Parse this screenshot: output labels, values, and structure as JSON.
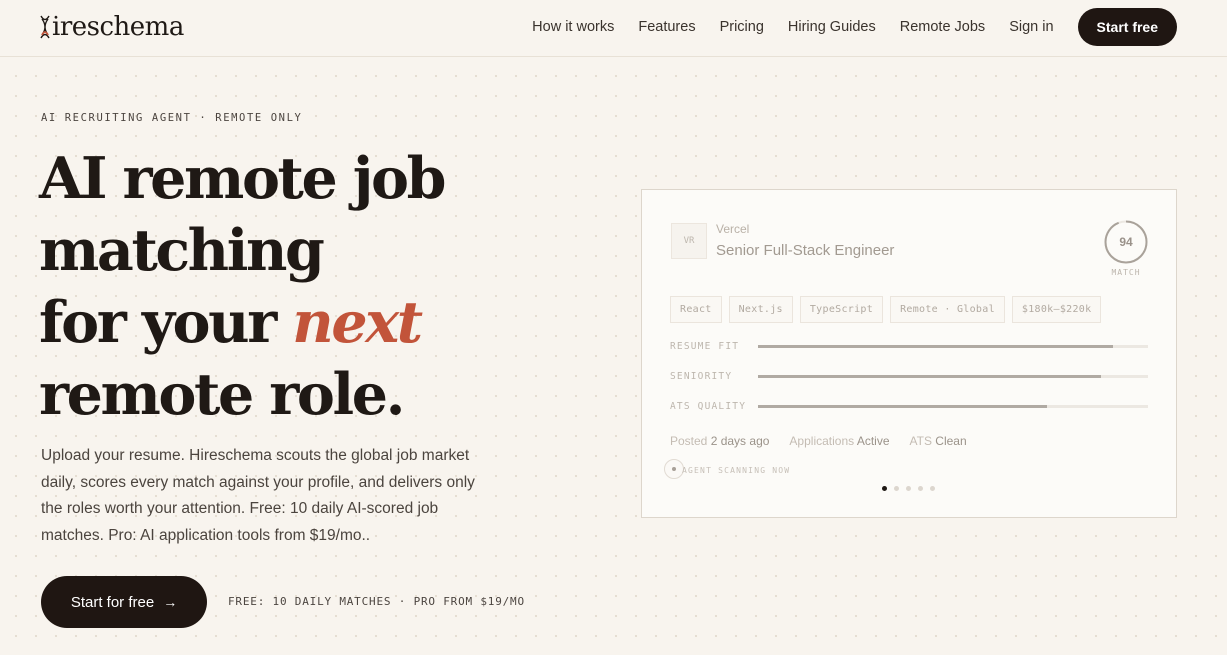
{
  "brand": {
    "name": "ireschema",
    "mark_color": "#c2543a"
  },
  "nav": {
    "links": [
      "How it works",
      "Features",
      "Pricing",
      "Hiring Guides",
      "Remote Jobs",
      "Sign in"
    ],
    "cta": "Start free"
  },
  "hero": {
    "eyebrow": "AI RECRUITING AGENT · REMOTE ONLY",
    "headline_line1": "AI remote job",
    "headline_line2": "matching",
    "headline_line3_pre": "for your ",
    "headline_accent": "next",
    "headline_line4": "remote role.",
    "lede": "Upload your resume. Hireschema scouts the global job market daily, scores every match against your profile, and delivers only the roles worth your attention. Free: 10 daily AI-scored job matches. Pro: AI application tools from $19/mo..",
    "cta": "Start for free",
    "cta_arrow": "→",
    "cta_note": "FREE: 10 DAILY MATCHES · PRO FROM $19/MO"
  },
  "card": {
    "company_initials": "VR",
    "company": "Vercel",
    "title": "Senior Full-Stack Engineer",
    "score": 94,
    "score_label": "MATCH",
    "tags": [
      "React",
      "Next.js",
      "TypeScript",
      "Remote · Global",
      "$180k–$220k"
    ],
    "metrics": [
      {
        "label": "RESUME FIT",
        "value": 0.91
      },
      {
        "label": "SENIORITY",
        "value": 0.88
      },
      {
        "label": "ATS QUALITY",
        "value": 0.74
      }
    ],
    "meta": {
      "posted_label": "Posted",
      "posted_value": "2 days ago",
      "applications_label": "Applications",
      "applications_value": "Active",
      "ats_label": "ATS",
      "ats_value": "Clean"
    },
    "agent_status": "AGENT SCANNING NOW",
    "carousel": {
      "count": 5,
      "active": 0
    }
  },
  "colors": {
    "accent": "#c2543a",
    "dark": "#1f1612",
    "background": "#f8f4ee"
  }
}
